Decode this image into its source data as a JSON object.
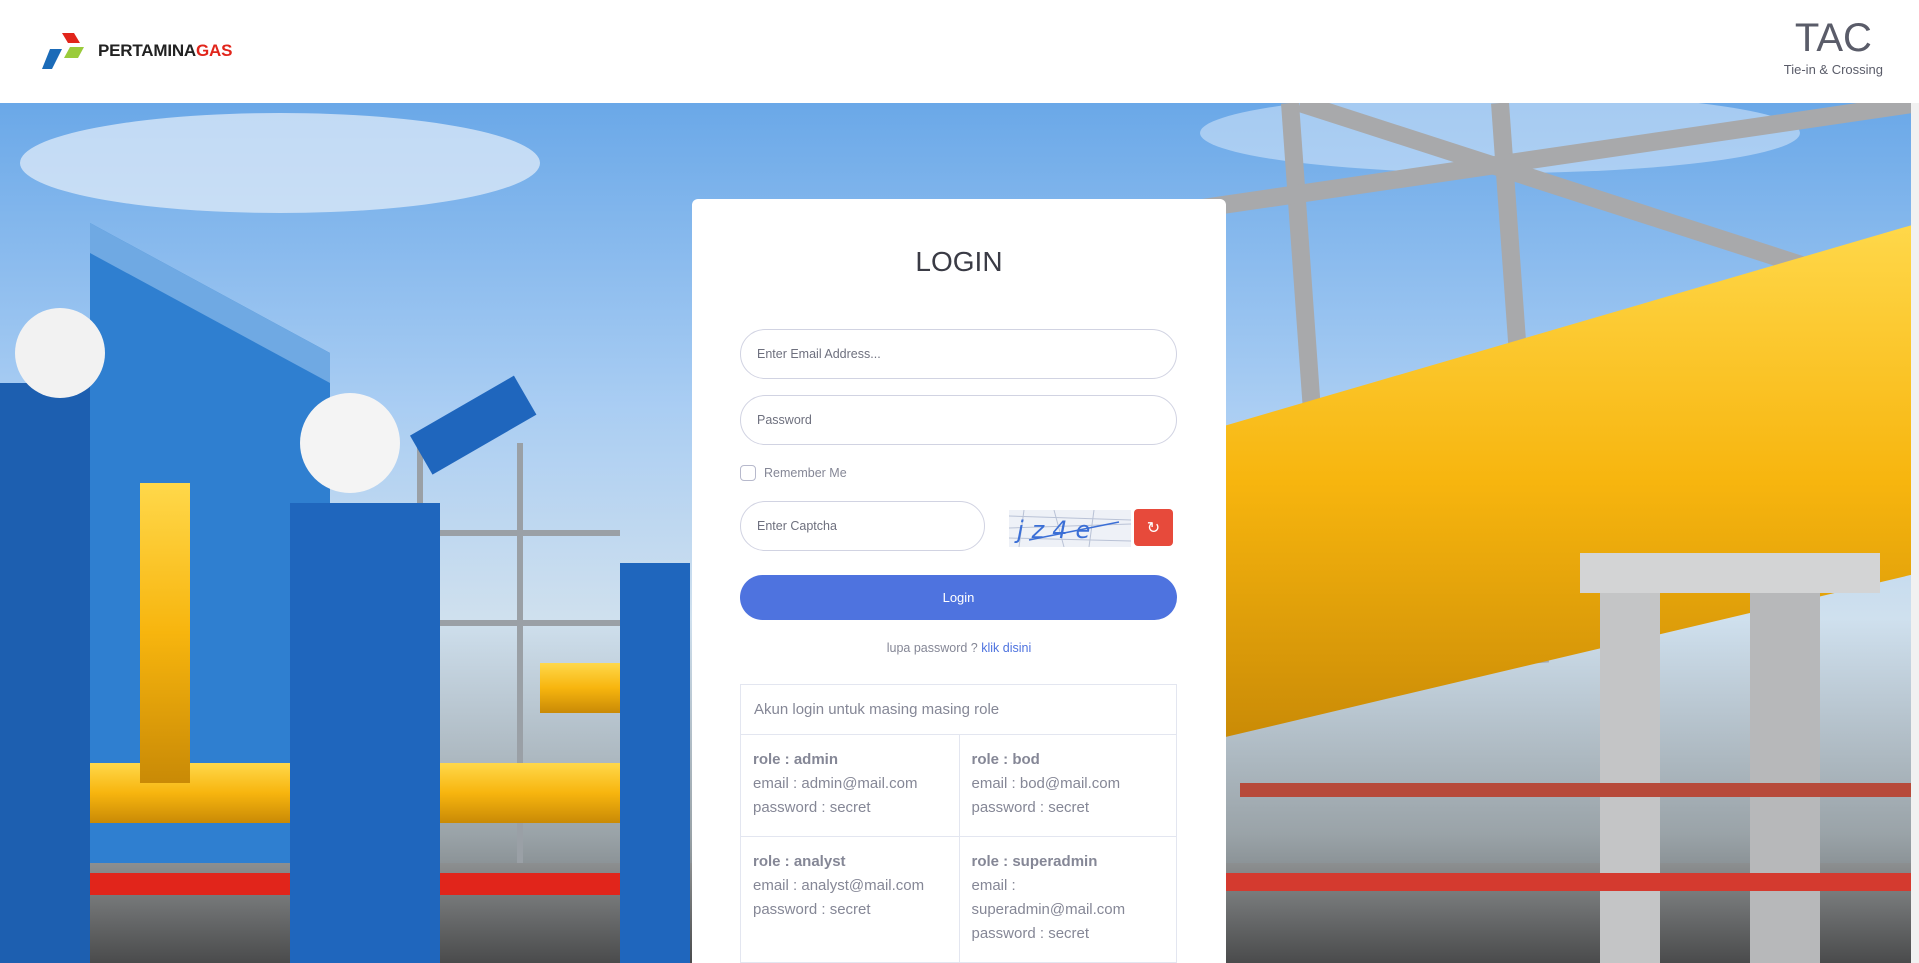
{
  "header": {
    "logo_text": "PERTAMINA",
    "logo_text_accent": "GAS",
    "app_title": "TAC",
    "app_subtitle": "Tie-in & Crossing"
  },
  "login": {
    "title": "LOGIN",
    "email_placeholder": "Enter Email Address...",
    "password_placeholder": "Password",
    "remember_label": "Remember Me",
    "captcha_placeholder": "Enter Captcha",
    "captcha_text": "jz4e",
    "refresh_icon": "↻",
    "login_button": "Login",
    "forgot_text": "lupa password ?",
    "forgot_link": "klik disini"
  },
  "accounts": {
    "heading": "Akun login untuk masing masing role",
    "rows": [
      [
        {
          "role": "role : admin",
          "email": "email : admin@mail.com",
          "password": "password : secret"
        },
        {
          "role": "role : bod",
          "email": "email : bod@mail.com",
          "password": "password : secret"
        }
      ],
      [
        {
          "role": "role : analyst",
          "email": "email : analyst@mail.com",
          "password": "password : secret"
        },
        {
          "role": "role : superadmin",
          "email": "email : superadmin@mail.com",
          "password": "password : secret"
        }
      ]
    ]
  },
  "colors": {
    "primary": "#4e73df",
    "danger": "#e74a3b",
    "text_muted": "#858796",
    "brand_red": "#e1251b"
  }
}
